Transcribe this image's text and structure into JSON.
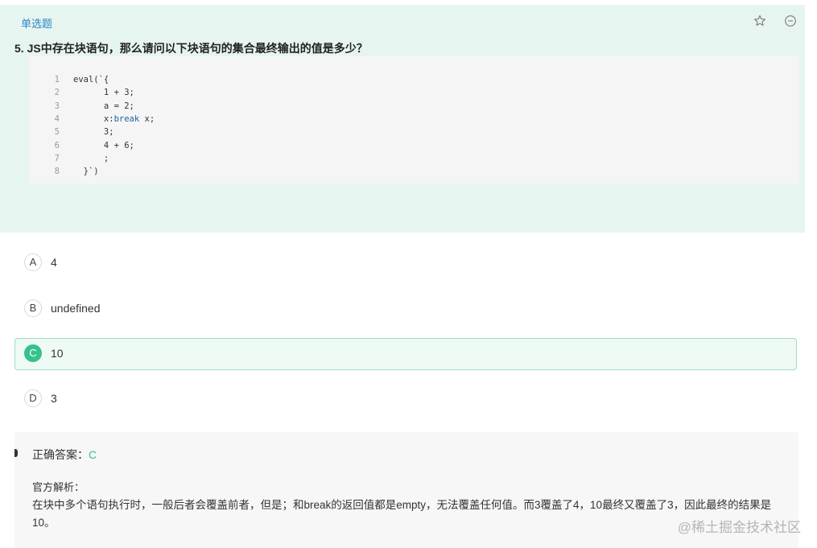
{
  "question": {
    "type_label": "单选题",
    "title": "5. JS中存在块语句，那么请问以下块语句的集合最终输出的值是多少？",
    "icons": [
      "star-icon",
      "minus-circle-icon"
    ],
    "code_lines": [
      {
        "num": "1",
        "pre": "eval(`{",
        "kw": "",
        "post": ""
      },
      {
        "num": "2",
        "pre": "      1 + 3;",
        "kw": "",
        "post": ""
      },
      {
        "num": "3",
        "pre": "      a = 2;",
        "kw": "",
        "post": ""
      },
      {
        "num": "4",
        "pre": "      x:",
        "kw": "break",
        "post": " x;"
      },
      {
        "num": "5",
        "pre": "      3;",
        "kw": "",
        "post": ""
      },
      {
        "num": "6",
        "pre": "      4 + 6;",
        "kw": "",
        "post": ""
      },
      {
        "num": "7",
        "pre": "      ;",
        "kw": "",
        "post": ""
      },
      {
        "num": "8",
        "pre": "  }`)",
        "kw": "",
        "post": ""
      }
    ]
  },
  "options": [
    {
      "letter": "A",
      "text": "4",
      "selected": false
    },
    {
      "letter": "B",
      "text": "undefined",
      "selected": false
    },
    {
      "letter": "C",
      "text": "10",
      "selected": true
    },
    {
      "letter": "D",
      "text": "3",
      "selected": false
    }
  ],
  "answer": {
    "label": "正确答案：",
    "value": "C",
    "explanation_title": "官方解析：",
    "explanation": "在块中多个语句执行时，一般后者会覆盖前者，但是；和break的返回值都是empty，无法覆盖任何值。而3覆盖了4，10最终又覆盖了3，因此最终的结果是10。"
  },
  "watermark": "@稀土掘金技术社区",
  "colors": {
    "accent": "#36c28a",
    "panel": "#e7f5f0",
    "type_label": "#2b87c9"
  }
}
